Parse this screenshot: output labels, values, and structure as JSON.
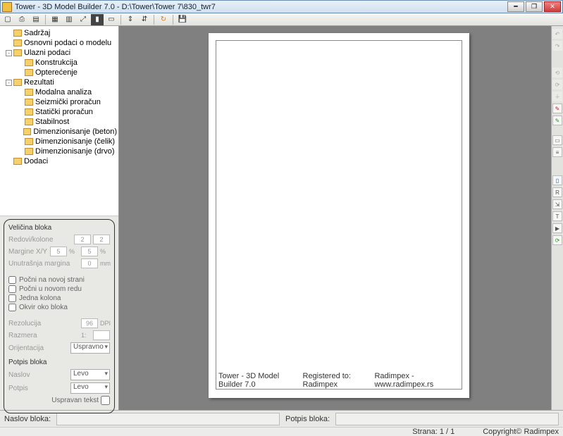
{
  "title": "Tower - 3D Model Builder 7.0 - D:\\Tower\\Tower 7\\830_twr7",
  "tree": [
    {
      "indent": 0,
      "toggle": "",
      "label": "Sadržaj"
    },
    {
      "indent": 0,
      "toggle": "",
      "label": "Osnovni podaci o modelu"
    },
    {
      "indent": 0,
      "toggle": "-",
      "label": "Ulazni podaci"
    },
    {
      "indent": 1,
      "toggle": "",
      "label": "Konstrukcija"
    },
    {
      "indent": 1,
      "toggle": "",
      "label": "Opterećenje"
    },
    {
      "indent": 0,
      "toggle": "-",
      "label": "Rezultati"
    },
    {
      "indent": 1,
      "toggle": "",
      "label": "Modalna analiza"
    },
    {
      "indent": 1,
      "toggle": "",
      "label": "Seizmički proračun"
    },
    {
      "indent": 1,
      "toggle": "",
      "label": "Statički proračun"
    },
    {
      "indent": 1,
      "toggle": "",
      "label": "Stabilnost"
    },
    {
      "indent": 1,
      "toggle": "",
      "label": "Dimenzionisanje (beton)"
    },
    {
      "indent": 1,
      "toggle": "",
      "label": "Dimenzionisanje (čelik)"
    },
    {
      "indent": 1,
      "toggle": "",
      "label": "Dimenzionisanje (drvo)"
    },
    {
      "indent": 0,
      "toggle": "",
      "label": "Dodaci"
    }
  ],
  "props": {
    "velicina_title": "Veličina bloka",
    "redovi_label": "Redovi/kolone",
    "redovi_v1": "2",
    "redovi_v2": "2",
    "margine_label": "Margine X/Y",
    "margine_v1": "5",
    "margine_u1": "%",
    "margine_v2": "5",
    "margine_u2": "%",
    "unutr_label": "Unutrašnja margina",
    "unutr_v": "0",
    "unutr_u": "mm",
    "chk1": "Počni na novoj strani",
    "chk2": "Počni u novom redu",
    "chk3": "Jedna kolona",
    "chk4": "Okvir oko bloka",
    "rez_label": "Rezolucija",
    "rez_v": "96",
    "rez_u": "DPI",
    "razm_label": "Razmera",
    "razm_pre": "1:",
    "razm_v": "",
    "orient_label": "Orijentacija",
    "orient_v": "Uspravno",
    "potpis_title": "Potpis bloka",
    "naslov_label": "Naslov",
    "naslov_v": "Levo",
    "potpis_label": "Potpis",
    "potpis_v": "Levo",
    "uspravan_label": "Uspravan tekst"
  },
  "page_footer": {
    "left": "Tower - 3D Model Builder 7.0",
    "center": "Registered to: Radimpex",
    "right": "Radimpex - www.radimpex.rs"
  },
  "status": {
    "naslov": "Naslov bloka:",
    "potpis": "Potpis bloka:",
    "strana": "Strana: 1 / 1",
    "copyright": "Copyright© Radimpex"
  }
}
